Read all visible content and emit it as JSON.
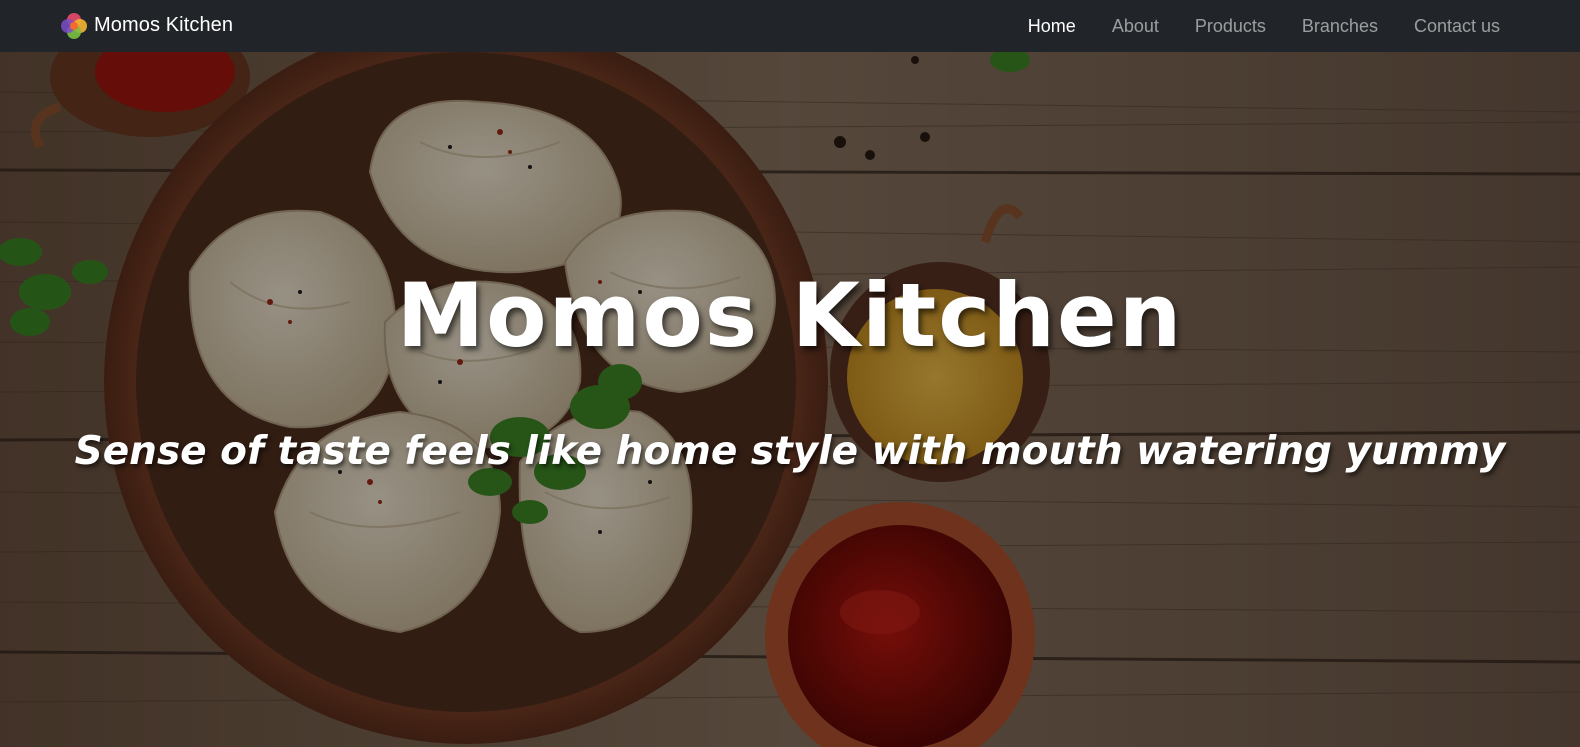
{
  "navbar": {
    "brand": "Momos Kitchen",
    "links": [
      {
        "label": "Home",
        "active": true
      },
      {
        "label": "About",
        "active": false
      },
      {
        "label": "Products",
        "active": false
      },
      {
        "label": "Branches",
        "active": false
      },
      {
        "label": "Contact us",
        "active": false
      }
    ]
  },
  "hero": {
    "title": "Momos Kitchen",
    "subtitle": "Sense of taste feels like home style with mouth watering yummy",
    "background_image": "momos-on-wooden-table-photo"
  },
  "colors": {
    "navbar_bg": "#212529",
    "nav_active": "#ffffff",
    "nav_inactive": "#8c8c8c",
    "hero_text": "#ffffff"
  }
}
